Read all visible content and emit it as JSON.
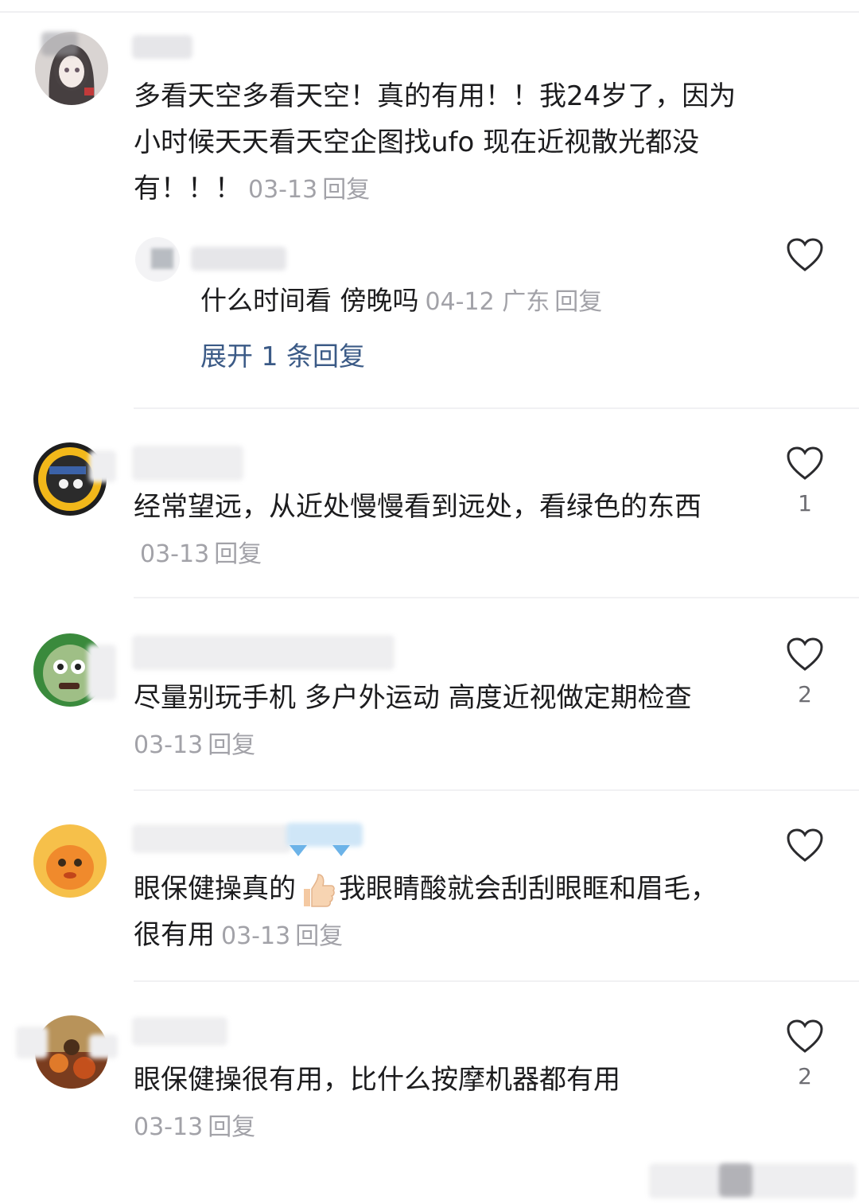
{
  "comments": [
    {
      "text": "多看天空多看天空！真的有用！！我24岁了，因为小时候天天看天空企图找ufo  现在近视散光都没有！！！",
      "date": "03-13",
      "reply_label": "回复",
      "sub_reply": {
        "text": "什么时间看 傍晚吗",
        "date": "04-12",
        "location": "广东",
        "reply_label": "回复",
        "expand_label": "展开 1 条回复"
      }
    },
    {
      "text": "经常望远，从近处慢慢看到远处，看绿色的东西",
      "date": "03-13",
      "reply_label": "回复",
      "likes": "1"
    },
    {
      "text": "尽量别玩手机 多户外运动 高度近视做定期检查",
      "date": "03-13",
      "reply_label": "回复",
      "likes": "2"
    },
    {
      "text_before_emoji": "眼保健操真的",
      "emoji": "thumbs-up",
      "text_after_emoji": "我眼睛酸就会刮刮眼眶和眉毛，很有用",
      "date": "03-13",
      "reply_label": "回复"
    },
    {
      "text": "眼保健操很有用，比什么按摩机器都有用",
      "date": "03-13",
      "reply_label": "回复",
      "likes": "2"
    }
  ],
  "icons": {
    "like": "heart-outline-icon"
  },
  "colors": {
    "meta": "#a2a2a8",
    "link": "#3b5a86",
    "text": "#1c1c1e"
  }
}
